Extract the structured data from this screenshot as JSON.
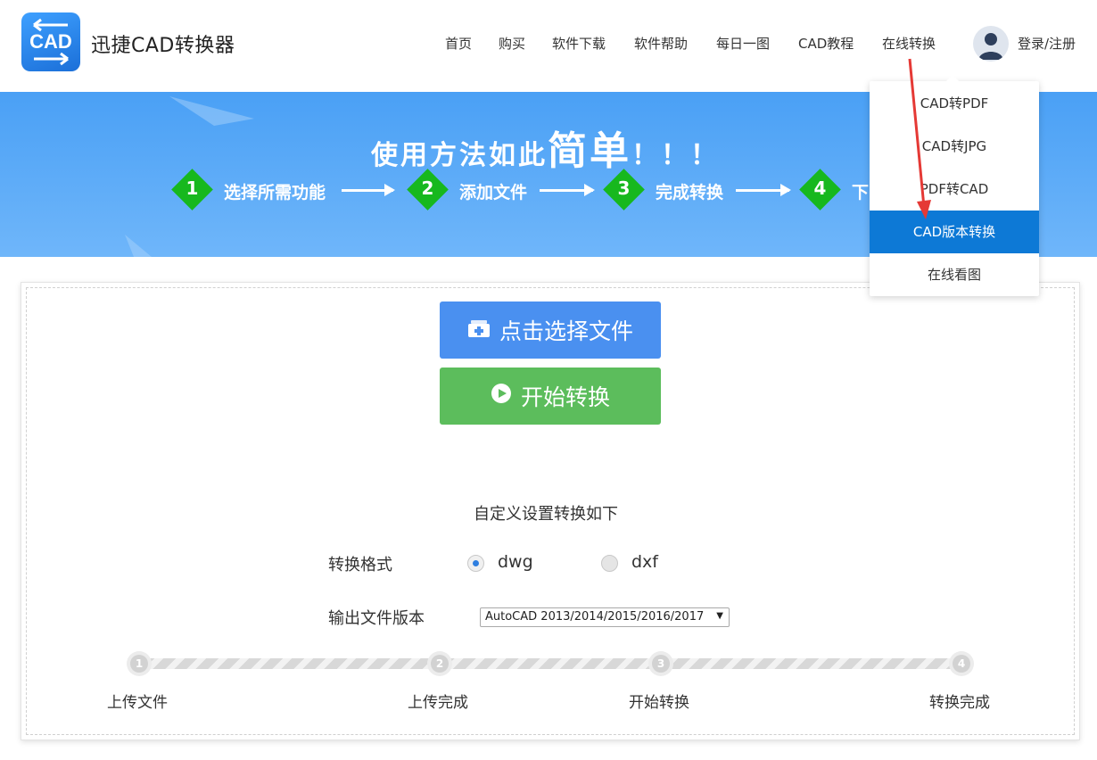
{
  "header": {
    "logo_text": "CAD",
    "app_title": "迅捷CAD转换器",
    "nav": [
      "首页",
      "购买",
      "软件下载",
      "软件帮助",
      "每日一图",
      "CAD教程",
      "在线转换"
    ],
    "login": "登录/注册"
  },
  "banner": {
    "title_a": "使用方法如此",
    "title_b": "简单",
    "title_c": "！！！",
    "steps": [
      {
        "num": "1",
        "label": "选择所需功能"
      },
      {
        "num": "2",
        "label": "添加文件"
      },
      {
        "num": "3",
        "label": "完成转换"
      },
      {
        "num": "4",
        "label": "下"
      }
    ]
  },
  "dropdown": {
    "items": [
      "CAD转PDF",
      "CAD转JPG",
      "PDF转CAD",
      "CAD版本转换",
      "在线看图"
    ],
    "active_index": 3
  },
  "main": {
    "select_button": "点击选择文件",
    "start_button": "开始转换",
    "settings_title": "自定义设置转换如下",
    "format_label": "转换格式",
    "format_options": [
      "dwg",
      "dxf"
    ],
    "format_selected": "dwg",
    "version_label": "输出文件版本",
    "version_value": "AutoCAD 2013/2014/2015/2016/2017"
  },
  "progress": {
    "steps": [
      {
        "num": "1",
        "label": "上传文件"
      },
      {
        "num": "2",
        "label": "上传完成"
      },
      {
        "num": "3",
        "label": "开始转换"
      },
      {
        "num": "4",
        "label": "转换完成"
      }
    ]
  },
  "colors": {
    "brand_blue": "#4a90f0",
    "start_green": "#5cbd5c",
    "dropdown_active": "#0d79d6",
    "step_diamond": "#17b81e",
    "annotation_arrow": "#e53935"
  }
}
